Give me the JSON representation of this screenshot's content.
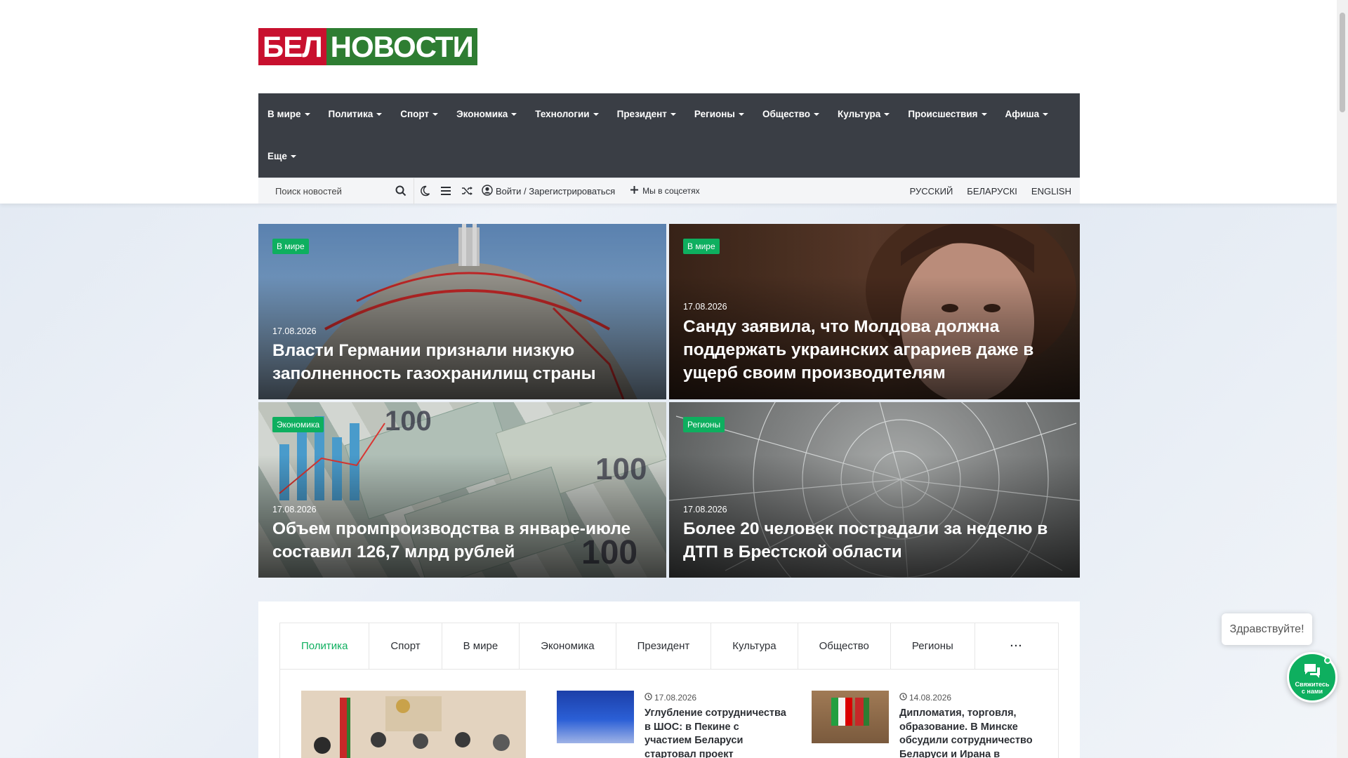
{
  "header": {
    "logo_part1": "БЕЛ",
    "logo_part2": "НОВОСТИ"
  },
  "nav": {
    "items": [
      "В мире",
      "Политика",
      "Спорт",
      "Экономика",
      "Технологии",
      "Президент",
      "Регионы",
      "Общество",
      "Культура",
      "Происшествия",
      "Афиша",
      "Еще"
    ]
  },
  "subbar": {
    "search_placeholder": "Поиск новостей",
    "login": "Войти / Зарегистрироваться",
    "social": "Мы в соцсетях",
    "languages": [
      "РУССКИЙ",
      "БЕЛАРУСКІ",
      "ENGLISH"
    ]
  },
  "featured": [
    {
      "category": "В мире",
      "date": "17.08.2026",
      "title": "Власти Германии признали низкую заполненность газохранилищ страны"
    },
    {
      "category": "В мире",
      "date": "17.08.2026",
      "title": "Санду заявила, что Молдова должна поддержать украинских аграриев даже в ущерб своим производителям"
    },
    {
      "category": "Экономика",
      "date": "17.08.2026",
      "title": "Объем промпроизводства в январе-июле составил 126,7 млрд рублей"
    },
    {
      "category": "Регионы",
      "date": "17.08.2026",
      "title": "Более 20 человек пострадали за неделю в ДТП в Брестской области"
    }
  ],
  "tabs": {
    "items": [
      "Политика",
      "Спорт",
      "В мире",
      "Экономика",
      "Президент",
      "Культура",
      "Общество",
      "Регионы"
    ],
    "more": "···",
    "active": "Политика"
  },
  "tab_news": [
    {
      "date": "17.08.2026",
      "title": "Углубление сотрудничества в ШОС: в Пекине с участием Беларуси стартовал проект"
    },
    {
      "date": "14.08.2026",
      "title": "Дипломатия, торговля, образование. В Минске обсудили сотрудничество Беларуси и Ирана в"
    }
  ],
  "chat": {
    "greeting": "Здравствуйте!",
    "button_label": "Свяжитесь с нами"
  },
  "colors": {
    "accent": "#0eaf5f",
    "nav_bg": "#3a3e45",
    "logo_red": "#c8102e",
    "logo_green": "#2e7d32"
  }
}
